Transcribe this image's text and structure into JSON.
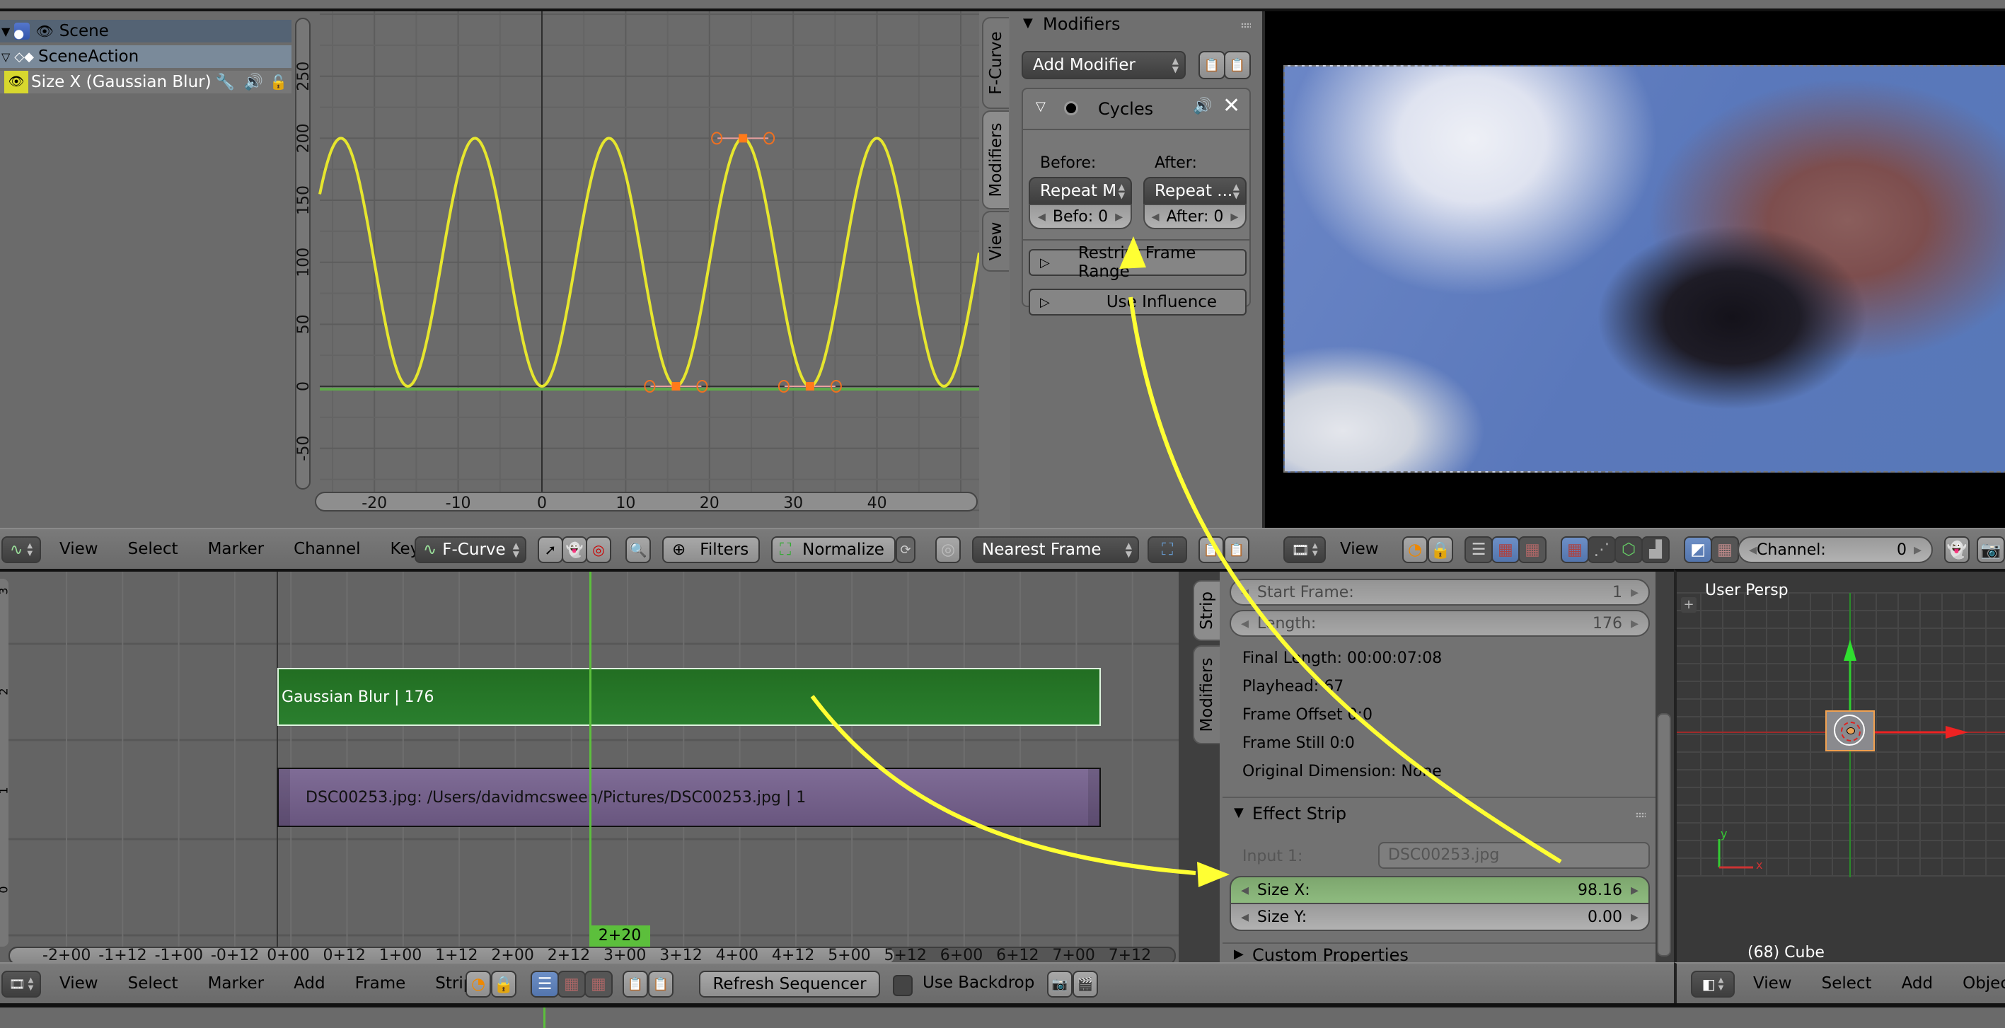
{
  "graph_editor": {
    "channels": [
      {
        "label": "Scene",
        "icon": "scene-icon"
      },
      {
        "label": "SceneAction",
        "icon": "action-icon"
      },
      {
        "label": "Size X (Gaussian Blur)",
        "icon": "eye-icon"
      }
    ],
    "y_ticks": [
      "250",
      "200",
      "150",
      "100",
      "50",
      "0",
      "-50"
    ],
    "x_ticks": [
      "-20",
      "-10",
      "0",
      "10",
      "20",
      "30",
      "40"
    ],
    "curve": {
      "min": 0,
      "max": 200,
      "period_frames": 16,
      "first_min_frame": 0,
      "keyframes": [
        {
          "frame": 16,
          "value": 0
        },
        {
          "frame": 24,
          "value": 200
        },
        {
          "frame": 32,
          "value": 0
        }
      ],
      "color": "#e6e62e"
    },
    "header": {
      "menus": [
        "View",
        "Select",
        "Marker",
        "Channel",
        "Key"
      ],
      "mode": "F-Curve",
      "filters_label": "Filters",
      "normalize_label": "Normalize",
      "snap": "Nearest Frame"
    },
    "side_tabs": [
      "F-Curve",
      "Modifiers",
      "View"
    ],
    "modifiers_panel": {
      "title": "Modifiers",
      "add_modifier": "Add Modifier",
      "modifier_name": "Cycles",
      "before_label": "Before:",
      "after_label": "After:",
      "before_mode": "Repeat M",
      "after_mode": "Repeat ...",
      "before_count_label": "Befo:",
      "before_count": "0",
      "after_count_label": "After:",
      "after_count": "0",
      "restrict_frame_range": "Restrict Frame Range",
      "use_influence": "Use Influence"
    }
  },
  "preview": {
    "header": {
      "menu": "View",
      "channel_label": "Channel:",
      "channel_value": "0"
    }
  },
  "sequencer": {
    "channel_numbers": [
      "3",
      "2",
      "1",
      "0"
    ],
    "strips": [
      {
        "label": "Gaussian Blur | 176",
        "type": "effect",
        "color": "#2a7a2a"
      },
      {
        "label": "DSC00253.jpg: /Users/davidmcsween/Pictures/DSC00253.jpg | 1",
        "type": "image",
        "color": "#6a5582"
      }
    ],
    "playhead_label": "2+20",
    "time_ticks": [
      "-2+00",
      "-1+12",
      "-1+00",
      "-0+12",
      "0+00",
      "0+12",
      "1+00",
      "1+12",
      "2+00",
      "2+12",
      "3+00",
      "3+12",
      "4+00",
      "4+12",
      "5+00",
      "5+12",
      "6+00",
      "6+12",
      "7+00",
      "7+12"
    ],
    "header": {
      "menus": [
        "View",
        "Select",
        "Marker",
        "Add",
        "Frame",
        "Strip"
      ],
      "refresh_label": "Refresh Sequencer",
      "use_backdrop_label": "Use Backdrop"
    },
    "side_tabs": [
      "Strip",
      "Modifiers"
    ],
    "strip_panel": {
      "start_frame_label": "Start Frame:",
      "start_frame": "1",
      "length_label": "Length:",
      "length": "176",
      "final_length": "Final Length: 00:00:07:08",
      "playhead": "Playhead: 67",
      "frame_offset": "Frame Offset 0:0",
      "frame_still": "Frame Still 0:0",
      "original_dimension": "Original Dimension: None"
    },
    "effect_panel": {
      "title": "Effect Strip",
      "input1_label": "Input 1:",
      "input1_value": "DSC00253.jpg",
      "size_x_label": "Size X:",
      "size_x_value": "98.16",
      "size_y_label": "Size Y:",
      "size_y_value": "0.00"
    },
    "custom_properties": "Custom Properties"
  },
  "viewport": {
    "view_name": "User Persp",
    "object_label": "(68) Cube",
    "header": {
      "menus": [
        "View",
        "Select",
        "Add",
        "Object"
      ]
    }
  },
  "annotation_color": "#ffff33"
}
